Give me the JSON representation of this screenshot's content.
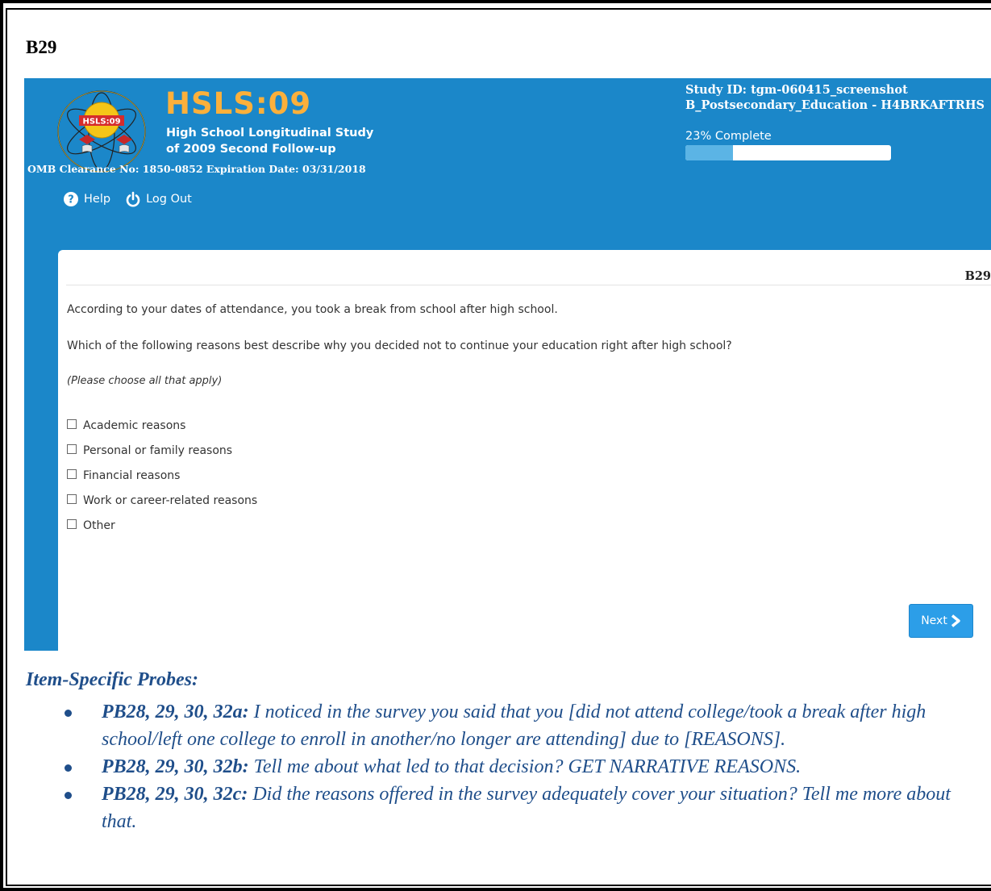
{
  "page_label": "B29",
  "header": {
    "logo_text": "HSLS:09",
    "title": "HSLS:09",
    "subtitle_line1": "High School Longitudinal Study",
    "subtitle_line2": "of 2009 Second Follow-up",
    "omb": "OMB Clearance No: 1850-0852 Expiration Date: 03/31/2018",
    "study_id": "Study ID: tgm-060415_screenshot",
    "section": "B_Postsecondary_Education - H4BRKAFTRHS",
    "progress_label": "23% Complete",
    "progress_value": 0.23
  },
  "nav": {
    "help": "Help",
    "logout": "Log Out"
  },
  "question": {
    "id": "B29",
    "intro": "According to your dates of attendance, you took a break from school after high school.",
    "prompt": "Which of the following reasons best describe why you decided not to continue your education right after high school?",
    "instruction": "(Please choose all that apply)",
    "options": [
      "Academic reasons",
      "Personal or family reasons",
      "Financial reasons",
      "Work or career-related reasons",
      "Other"
    ],
    "next_label": "Next"
  },
  "probes": {
    "title": "Item-Specific Probes:",
    "items": [
      {
        "label": "PB28, 29, 30, 32a:",
        "text": " I noticed in the survey you said that you [did not attend college/took a break after high school/left one college to enroll in another/no longer are attending] due to [REASONS]."
      },
      {
        "label": "PB28, 29, 30, 32b:",
        "text": " Tell me about what led to that decision?  GET NARRATIVE REASONS."
      },
      {
        "label": "PB28, 29, 30, 32c:",
        "text": " Did the reasons offered in the survey adequately cover your situation? Tell me more about that."
      }
    ]
  },
  "colors": {
    "banner": "#1b87c9",
    "title": "#fbb03b",
    "probe_text": "#1f4e8a",
    "next_button": "#2c9ee8"
  }
}
